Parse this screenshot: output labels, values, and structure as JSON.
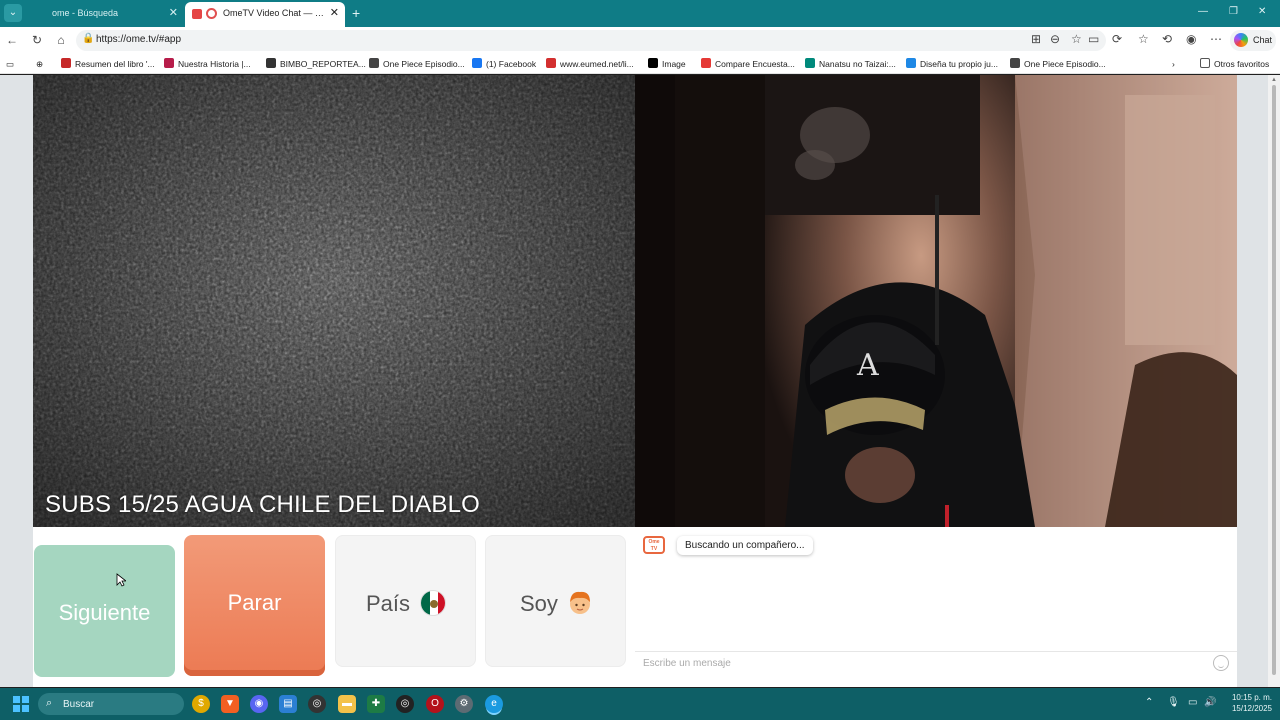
{
  "browser": {
    "tabs": [
      {
        "title": "ome - Búsqueda"
      },
      {
        "title": "OmeTV Video Chat — Omegl"
      }
    ],
    "url": "https://ome.tv/#app",
    "copilot_label": "Chat",
    "bookmarks": [
      {
        "label": "Resumen del libro '...",
        "icon": "red-l-icon",
        "color": "#c62828"
      },
      {
        "label": "Nuestra Historia |...",
        "icon": "bookmark-site-icon",
        "color": "#b71c4a"
      },
      {
        "label": "BIMBO_REPORTEA...",
        "icon": "github-icon",
        "color": "#333333"
      },
      {
        "label": "One Piece Episodio...",
        "icon": "af-icon",
        "color": "#444444"
      },
      {
        "label": "(1) Facebook",
        "icon": "facebook-icon",
        "color": "#1877f2"
      },
      {
        "label": "www.eumed.net/li...",
        "icon": "eumed-icon",
        "color": "#d32f2f"
      },
      {
        "label": "Image",
        "icon": "x-icon",
        "color": "#000000"
      },
      {
        "label": "Compare Encuesta...",
        "icon": "compare-icon",
        "color": "#e53935"
      },
      {
        "label": "Nanatsu no Taizai:...",
        "icon": "nanatsu-icon",
        "color": "#00897b"
      },
      {
        "label": "Diseña tu propio ju...",
        "icon": "design-icon",
        "color": "#1e88e5"
      },
      {
        "label": "One Piece Episodio...",
        "icon": "af-icon",
        "color": "#444444"
      }
    ],
    "other_bookmarks": "Otros favoritos"
  },
  "app": {
    "caption": "SUBS 15/25 AGUA CHILE DEL DIABLO",
    "buttons": {
      "next": "Siguiente",
      "stop": "Parar",
      "country": "País",
      "gender": "Soy"
    },
    "chat": {
      "logo": "Ome TV",
      "status_message": "Buscando un compañero...",
      "input_placeholder": "Escribe un mensaje"
    },
    "accent_color": "#ec7a53",
    "next_color": "#a5d6c0"
  },
  "taskbar": {
    "search_placeholder": "Buscar",
    "time": "10:15 p. m.",
    "date": "15/12/2025"
  }
}
